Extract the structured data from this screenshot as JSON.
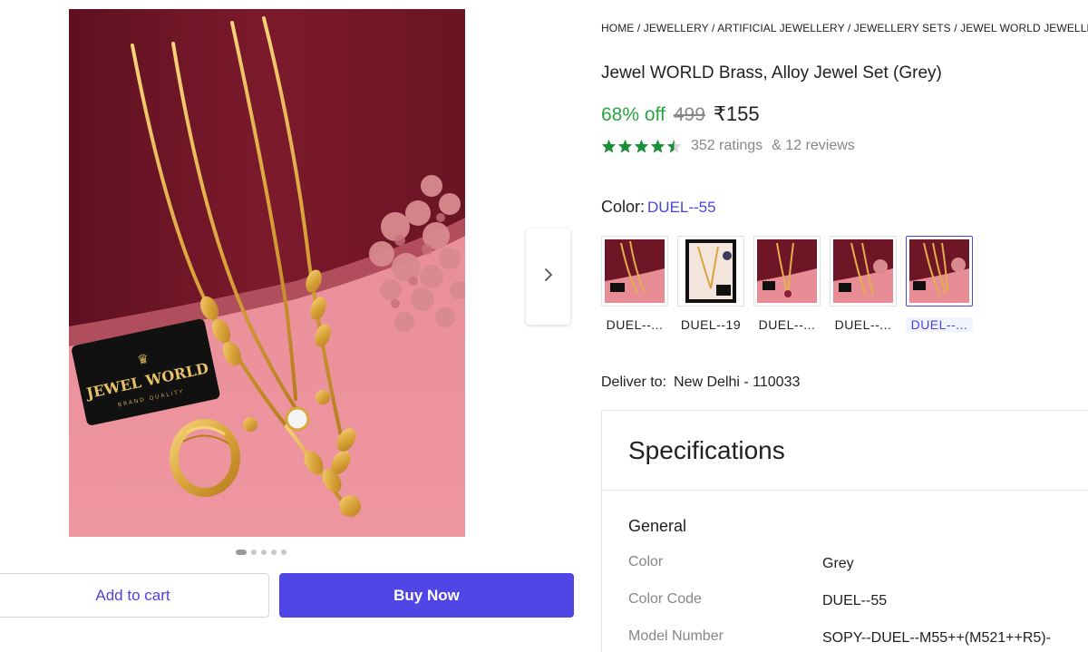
{
  "breadcrumb": {
    "items": [
      "HOME",
      "JEWELLERY",
      "ARTIFICIAL JEWELLERY",
      "JEWELLERY SETS",
      "JEWEL WORLD JEWELLERY"
    ],
    "separator": " / "
  },
  "product": {
    "title": "Jewel WORLD Brass, Alloy Jewel Set (Grey)",
    "discount": "68% off",
    "mrp": "499",
    "price": "₹155",
    "rating_value": 4.3,
    "ratings_text": "352 ratings",
    "reviews_text": "& 12 reviews"
  },
  "image": {
    "brand_line1": "JEWEL WORLD",
    "brand_line2": "BRAND QUALITY",
    "dots_total": 5,
    "dots_active": 0
  },
  "color": {
    "label": "Color:",
    "selected": "DUEL--55",
    "swatches": [
      {
        "label": "DUEL--...",
        "selected": false
      },
      {
        "label": "DUEL--19",
        "selected": false
      },
      {
        "label": "DUEL--...",
        "selected": false
      },
      {
        "label": "DUEL--...",
        "selected": false
      },
      {
        "label": "DUEL--...",
        "selected": true
      }
    ]
  },
  "delivery": {
    "label": "Deliver to:",
    "location": "New Delhi - 110033"
  },
  "actions": {
    "add_to_cart": "Add to cart",
    "buy_now": "Buy Now"
  },
  "specs": {
    "title": "Specifications",
    "section": "General",
    "rows": [
      {
        "key": "Color",
        "value": "Grey"
      },
      {
        "key": "Color Code",
        "value": "DUEL--55"
      },
      {
        "key": "Model Number",
        "value": "SOPY--DUEL--M55++(M521++R5)-"
      }
    ]
  },
  "colors": {
    "accent": "#4f46e5",
    "link": "#4d43dd",
    "discount_green": "#26a541",
    "star_green": "#1a8f3a"
  },
  "icons": {
    "next": "chevron-right-icon",
    "star": "star-icon"
  }
}
